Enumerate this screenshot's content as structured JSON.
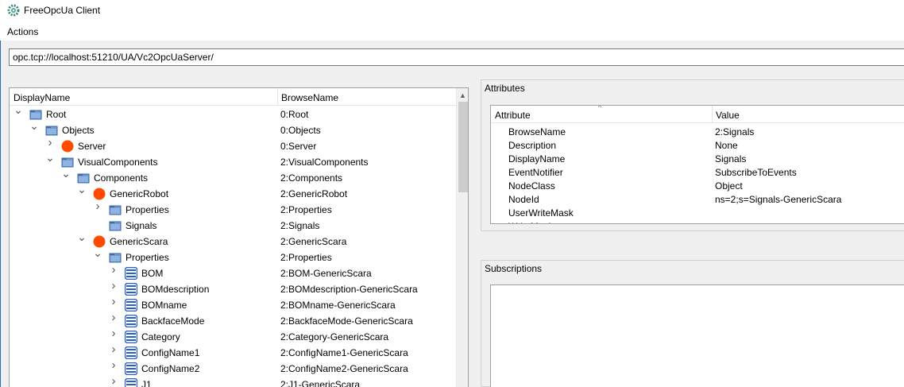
{
  "window": {
    "title": "FreeOpcUa Client"
  },
  "menu": {
    "actions": "Actions"
  },
  "address": {
    "value": "opc.tcp://localhost:51210/UA/Vc2OpcUaServer/"
  },
  "tree": {
    "col_display": "DisplayName",
    "col_browse": "BrowseName",
    "rows": [
      {
        "name": "Root",
        "browse": "0:Root",
        "level": 0,
        "expander": "expanded",
        "icon": "folder-icon"
      },
      {
        "name": "Objects",
        "browse": "0:Objects",
        "level": 1,
        "expander": "expanded",
        "icon": "folder-icon"
      },
      {
        "name": "Server",
        "browse": "0:Server",
        "level": 2,
        "expander": "collapsed",
        "icon": "object-icon"
      },
      {
        "name": "VisualComponents",
        "browse": "2:VisualComponents",
        "level": 2,
        "expander": "expanded",
        "icon": "folder-icon"
      },
      {
        "name": "Components",
        "browse": "2:Components",
        "level": 3,
        "expander": "expanded",
        "icon": "folder-icon"
      },
      {
        "name": "GenericRobot",
        "browse": "2:GenericRobot",
        "level": 4,
        "expander": "expanded",
        "icon": "object-icon"
      },
      {
        "name": "Properties",
        "browse": "2:Properties",
        "level": 5,
        "expander": "collapsed",
        "icon": "folder-icon"
      },
      {
        "name": "Signals",
        "browse": "2:Signals",
        "level": 5,
        "expander": "none",
        "icon": "folder-icon"
      },
      {
        "name": "GenericScara",
        "browse": "2:GenericScara",
        "level": 4,
        "expander": "expanded",
        "icon": "object-icon"
      },
      {
        "name": "Properties",
        "browse": "2:Properties",
        "level": 5,
        "expander": "expanded",
        "icon": "folder-icon"
      },
      {
        "name": "BOM",
        "browse": "2:BOM-GenericScara",
        "level": 6,
        "expander": "collapsed",
        "icon": "variable-icon"
      },
      {
        "name": "BOMdescription",
        "browse": "2:BOMdescription-GenericScara",
        "level": 6,
        "expander": "collapsed",
        "icon": "variable-icon"
      },
      {
        "name": "BOMname",
        "browse": "2:BOMname-GenericScara",
        "level": 6,
        "expander": "collapsed",
        "icon": "variable-icon"
      },
      {
        "name": "BackfaceMode",
        "browse": "2:BackfaceMode-GenericScara",
        "level": 6,
        "expander": "collapsed",
        "icon": "variable-icon"
      },
      {
        "name": "Category",
        "browse": "2:Category-GenericScara",
        "level": 6,
        "expander": "collapsed",
        "icon": "variable-icon"
      },
      {
        "name": "ConfigName1",
        "browse": "2:ConfigName1-GenericScara",
        "level": 6,
        "expander": "collapsed",
        "icon": "variable-icon"
      },
      {
        "name": "ConfigName2",
        "browse": "2:ConfigName2-GenericScara",
        "level": 6,
        "expander": "collapsed",
        "icon": "variable-icon"
      },
      {
        "name": "J1",
        "browse": "2:J1-GenericScara",
        "level": 6,
        "expander": "collapsed",
        "icon": "variable-icon"
      }
    ]
  },
  "attributes": {
    "title": "Attributes",
    "col_attr": "Attribute",
    "col_value": "Value",
    "rows": [
      {
        "key": "BrowseName",
        "value": "2:Signals"
      },
      {
        "key": "Description",
        "value": "None"
      },
      {
        "key": "DisplayName",
        "value": "Signals"
      },
      {
        "key": "EventNotifier",
        "value": "SubscribeToEvents"
      },
      {
        "key": "NodeClass",
        "value": "Object"
      },
      {
        "key": "NodeId",
        "value": "ns=2;s=Signals-GenericScara"
      },
      {
        "key": "UserWriteMask",
        "value": ""
      },
      {
        "key": "WriteMask",
        "value": ""
      }
    ]
  },
  "subscriptions": {
    "title": "Subscriptions"
  },
  "colors": {
    "object": "#ff4a00",
    "folder": "#4a7ebb",
    "variable": "#2a5fd0",
    "accent": "#2b6cb8"
  }
}
